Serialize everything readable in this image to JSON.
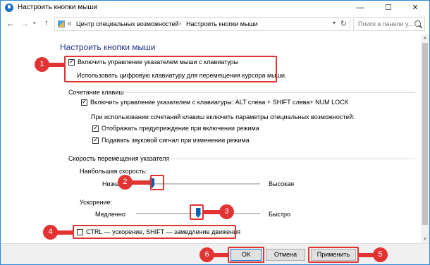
{
  "window": {
    "title": "Настроить кнопки мыши",
    "minimize": "—",
    "maximize": "☐",
    "close": "✕"
  },
  "nav": {
    "back": "←",
    "forward": "→",
    "history_dropdown": "▾",
    "up": "↑",
    "breadcrumb_sep": "«",
    "breadcrumb": [
      "Центр специальных возможностей",
      "Настроить кнопки мыши"
    ],
    "breadcrumb_arrow": "›",
    "address_dropdown": "▾",
    "refresh": "↻",
    "search_placeholder": "Поиск в панели у..."
  },
  "main": {
    "page_title": "Настроить кнопки мыши",
    "enable_mousekeys": "Включить управление указателем мыши с клавиатуры",
    "use_numpad": "Использовать цифровую клавиатуру для перемещения курсора мыши.",
    "shortcut_section": "Сочетание клавиш",
    "shortcut_enable": "Включить управление указателем с клавиатуры: ALT слева + SHIFT слева+ NUM LOCK",
    "shortcut_hint": "При использовании сочетаний клавиш включить параметры специальных возможностей:",
    "show_warning": "Отображать предупреждение при включении режима",
    "play_sound": "Подавать звуковой сигнал при изменении режима",
    "speed_section": "Скорость перемещения указателя",
    "top_speed_label": "Наибольшая скорость:",
    "top_speed_low": "Низкая",
    "top_speed_high": "Высокая",
    "accel_label": "Ускорение:",
    "accel_low": "Медленно",
    "accel_high": "Быстро",
    "ctrl_shift": "CTRL — ускорение, SHIFT — замедление движения"
  },
  "controls": {
    "enable_mousekeys_checked": true,
    "shortcut_enable_checked": true,
    "show_warning_checked": true,
    "play_sound_checked": true,
    "ctrl_shift_checked": false,
    "top_speed_fraction": 0.13,
    "accel_fraction": 0.5
  },
  "buttons": {
    "ok": "ОК",
    "cancel": "Отмена",
    "apply": "Применить"
  },
  "callouts": [
    "1",
    "2",
    "3",
    "4",
    "5",
    "6"
  ],
  "colors": {
    "accent": "#0078d7",
    "title_blue": "#1e3287",
    "highlight_red": "#e23333"
  }
}
